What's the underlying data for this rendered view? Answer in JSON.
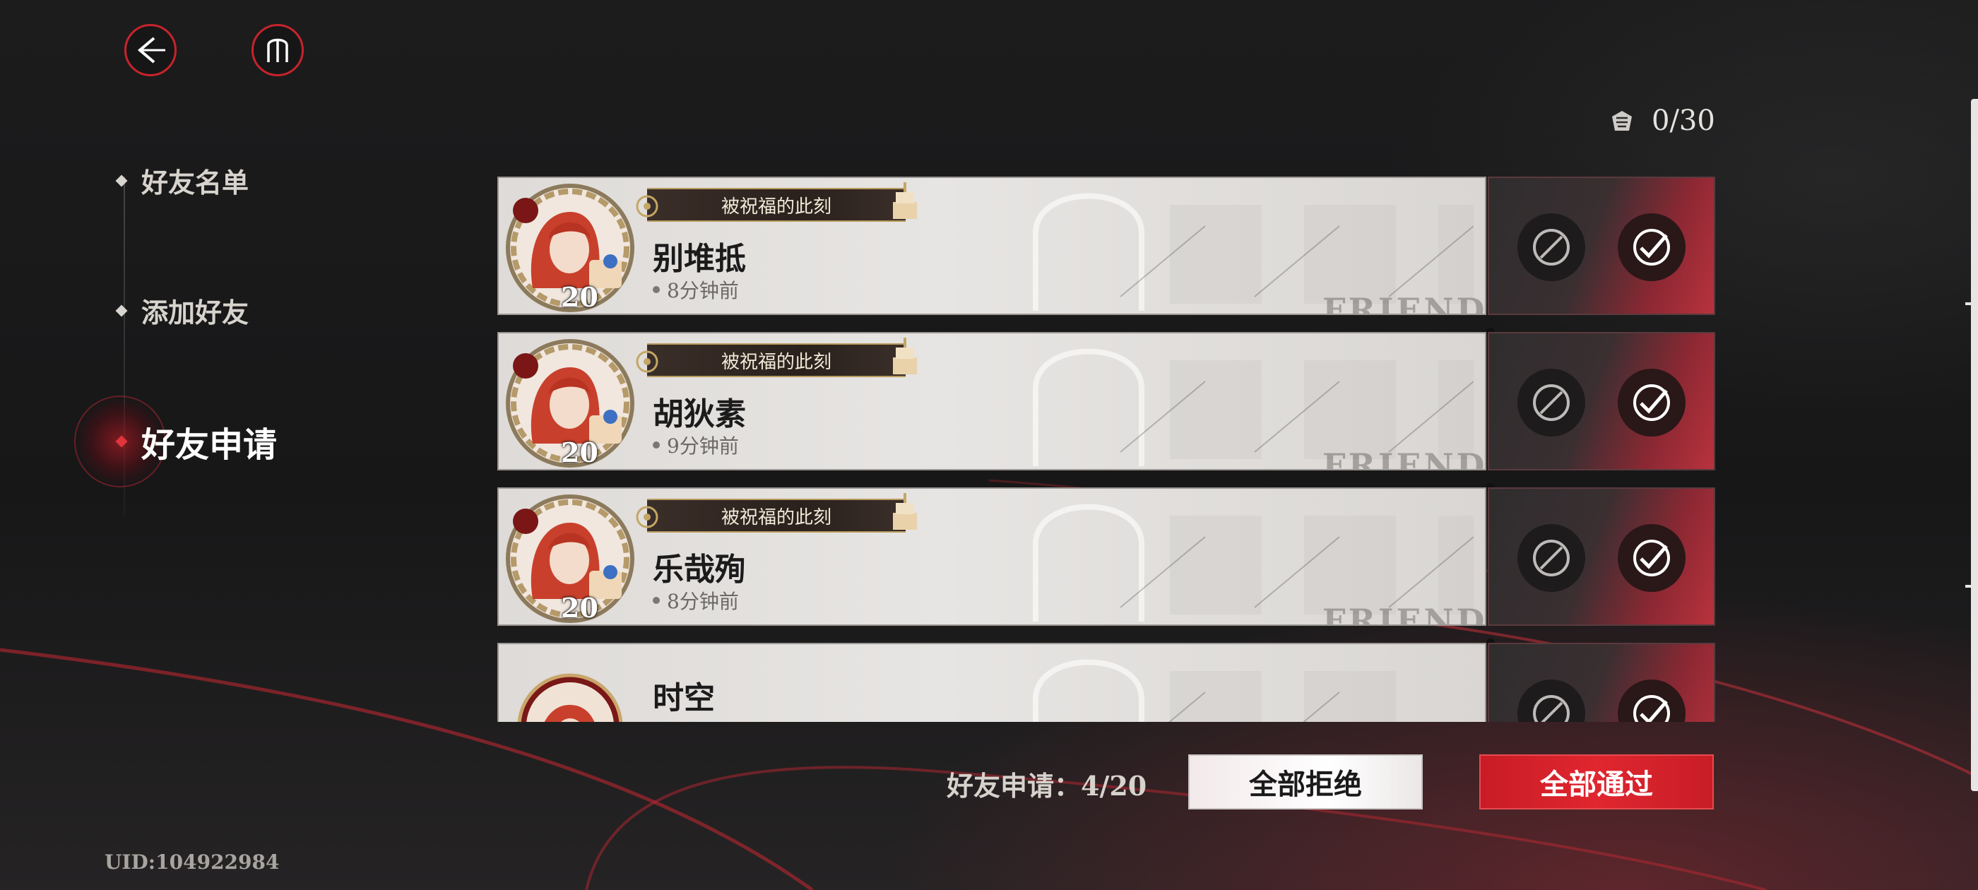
{
  "top_bar": {
    "back_icon": "back-arrow-icon",
    "home_icon": "home-icon"
  },
  "sidebar": {
    "items": [
      {
        "label": "好友名单",
        "active": false
      },
      {
        "label": "添加好友",
        "active": false
      },
      {
        "label": "好友申请",
        "active": true
      }
    ]
  },
  "counter": {
    "icon": "friend-badge-icon",
    "text": "0/30"
  },
  "requests": [
    {
      "title": "被祝福的此刻",
      "name": "别堆抵",
      "time": "8分钟前",
      "level": "20"
    },
    {
      "title": "被祝福的此刻",
      "name": "胡狄素",
      "time": "9分钟前",
      "level": "20"
    },
    {
      "title": "被祝福的此刻",
      "name": "乐哉殉",
      "time": "8分钟前",
      "level": "20"
    },
    {
      "title": "",
      "name": "时空",
      "time": "",
      "level": ""
    }
  ],
  "watermark": "FRIENDS",
  "bottom": {
    "request_count": "好友申请：4/20",
    "reject_all": "全部拒绝",
    "accept_all": "全部通过"
  },
  "uid": "UID:104922984",
  "colors": {
    "accent_red": "#d8222c",
    "card_bg": "#e2e0dd",
    "background": "#1a1a1b"
  }
}
